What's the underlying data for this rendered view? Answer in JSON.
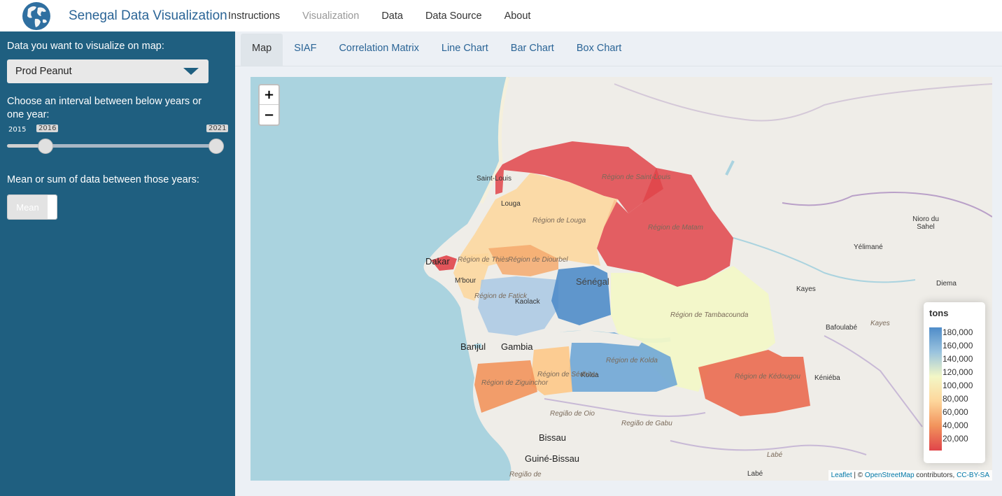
{
  "navbar": {
    "title": "Senegal Data Visualization",
    "items": [
      "Instructions",
      "Visualization",
      "Data",
      "Data Source",
      "About"
    ],
    "active": "Visualization"
  },
  "sidebar": {
    "data_label": "Data you want to visualize on map:",
    "selected_data": "Prod Peanut",
    "interval_label": "Choose an interval between below years or one year:",
    "slider": {
      "min": "2015",
      "max": "2021",
      "from": "2016",
      "to": "2021"
    },
    "mean_sum_label": "Mean or sum of data between those years:",
    "toggle_value": "Mean"
  },
  "tabs": [
    "Map",
    "SIAF",
    "Correlation Matrix",
    "Line Chart",
    "Bar Chart",
    "Box Chart"
  ],
  "active_tab": "Map",
  "map": {
    "zoom_in": "+",
    "zoom_out": "−",
    "legend": {
      "title": "tons",
      "ticks": [
        "180,000",
        "160,000",
        "140,000",
        "120,000",
        "100,000",
        "80,000",
        "60,000",
        "40,000",
        "20,000"
      ],
      "colors": [
        "#4f8cc9",
        "#9ac3de",
        "#f3f7c6",
        "#fdd69b",
        "#f2935c",
        "#e0444a"
      ]
    },
    "attribution": {
      "leaflet": "Leaflet",
      "sep": " | © ",
      "osm": "OpenStreetMap",
      "contrib": " contributors, ",
      "license": "CC-BY-SA"
    },
    "place_labels": {
      "saint_louis": "Saint-Louis",
      "louga": "Louga",
      "dakar": "Dakar",
      "mbour": "M'bour",
      "kaolack": "Kaolack",
      "senegal": "Sénégal",
      "banjul": "Banjul",
      "gambia": "Gambia",
      "kolda": "Kolda",
      "bissau": "Bissau",
      "guinea_bissau": "Guiné-Bissau",
      "kayes": "Kayes",
      "kayes_region": "Kayes",
      "bafoulabe": "Bafoulabé",
      "yelimane": "Yélimané",
      "nioro": "Nioro du Sahel",
      "diema": "Diema",
      "kenieba": "Kéniéba",
      "labe": "Labé",
      "labe_region": "Labé",
      "regiao_oio": "Região de Oio",
      "regiao_gabu": "Região de Gabu",
      "regiao_de": "Região de",
      "reg_saint_louis": "Région de Saint-Louis",
      "reg_louga": "Région de Louga",
      "reg_matam": "Région de Matam",
      "reg_thies": "Région de Thiès",
      "reg_diourbel": "Région de Diourbel",
      "reg_fatick": "Région de Fatick",
      "reg_tamba": "Région de Tambacounda",
      "reg_kolda": "Région de Kolda",
      "reg_sedhiou": "Région de Sédhiou",
      "reg_ziguinchor": "Région de Ziguinchor",
      "reg_kedougou": "Région de Kédougou"
    }
  }
}
